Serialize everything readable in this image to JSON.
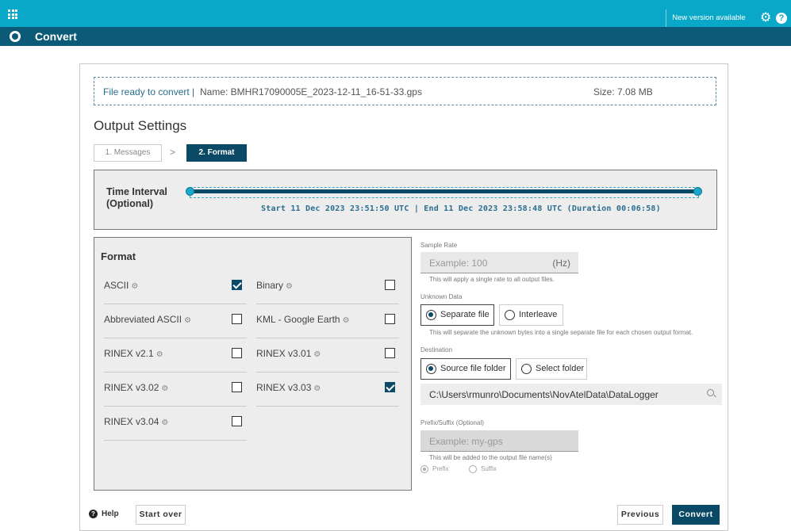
{
  "topbar": {
    "new_version": "New version available",
    "icons": [
      "app-grid-icon",
      "gear-icon",
      "help-icon"
    ],
    "color": "#0aa8c8"
  },
  "titlebar": {
    "title": "Convert",
    "color": "#0a5a78"
  },
  "file": {
    "status": "File ready to convert |",
    "name": "Name:  BMHR17090005E_2023-12-11_16-51-33.gps",
    "size": "Size:  7.08 MB"
  },
  "output_settings": {
    "title": "Output Settings",
    "steps": [
      {
        "label": "1. Messages",
        "active": false
      },
      {
        "label": "2. Format",
        "active": true
      }
    ],
    "step_separator": ">"
  },
  "time_interval": {
    "label": "Time Interval (Optional)",
    "range_text": "Start 11 Dec 2023 23:51:50 UTC | End 11 Dec 2023 23:58:48 UTC (Duration 00:06:58)"
  },
  "format": {
    "title": "Format",
    "items": [
      {
        "label": "ASCII",
        "checked": true
      },
      {
        "label": "Binary",
        "checked": false
      },
      {
        "label": "Abbreviated ASCII",
        "checked": false
      },
      {
        "label": "KML - Google Earth",
        "checked": false
      },
      {
        "label": "RINEX v2.1",
        "checked": false
      },
      {
        "label": "RINEX v3.01",
        "checked": false
      },
      {
        "label": "RINEX v3.02",
        "checked": false
      },
      {
        "label": "RINEX v3.03",
        "checked": true
      },
      {
        "label": "RINEX v3.04",
        "checked": false
      }
    ]
  },
  "sample_rate": {
    "label": "Sample Rate",
    "placeholder": "Example: 100",
    "unit": "(Hz)",
    "note": "This will apply a single rate to all output files."
  },
  "unknown_data": {
    "label": "Unknown Data",
    "options": [
      {
        "label": "Separate file",
        "selected": true
      },
      {
        "label": "Interleave",
        "selected": false
      }
    ],
    "note": "This will separate the unknown bytes into a single separate file for each chosen output format."
  },
  "destination": {
    "label": "Destination",
    "options": [
      {
        "label": "Source file folder",
        "selected": true
      },
      {
        "label": "Select folder",
        "selected": false
      }
    ],
    "path": "C:\\Users\\rmunro\\Documents\\NovAtelData\\DataLogger"
  },
  "prefix_suffix": {
    "label": "Prefix/Suffix (Optional)",
    "placeholder": "Example: my-gps",
    "note": "This will be added to the output file name(s)",
    "options": [
      {
        "label": "Prefix",
        "selected": true
      },
      {
        "label": "Suffix",
        "selected": false
      }
    ]
  },
  "footer": {
    "help": "Help",
    "start_over": "Start over",
    "previous": "Previous",
    "convert": "Convert"
  }
}
